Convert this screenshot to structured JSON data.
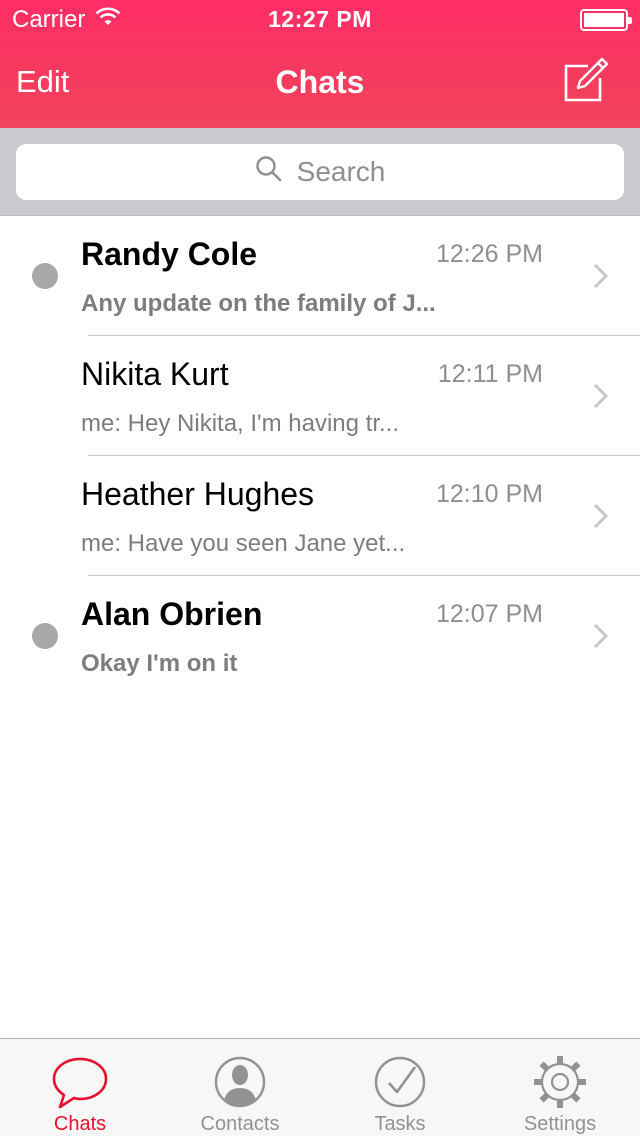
{
  "status_bar": {
    "carrier": "Carrier",
    "time": "12:27 PM"
  },
  "nav": {
    "edit_label": "Edit",
    "title": "Chats",
    "compose_icon": "compose-icon"
  },
  "search": {
    "placeholder": "Search"
  },
  "chats": [
    {
      "name": "Randy Cole",
      "time": "12:26 PM",
      "preview": "Any update on the family of J...",
      "unread": true
    },
    {
      "name": "Nikita Kurt",
      "time": "12:11 PM",
      "preview": "me: Hey Nikita, I'm having tr...",
      "unread": false
    },
    {
      "name": "Heather Hughes",
      "time": "12:10 PM",
      "preview": "me: Have you seen Jane yet...",
      "unread": false
    },
    {
      "name": "Alan Obrien",
      "time": "12:07 PM",
      "preview": "Okay I'm on it",
      "unread": true
    }
  ],
  "tabs": [
    {
      "label": "Chats",
      "icon": "chat-bubble-icon",
      "active": true
    },
    {
      "label": "Contacts",
      "icon": "person-icon",
      "active": false
    },
    {
      "label": "Tasks",
      "icon": "checkmark-icon",
      "active": false
    },
    {
      "label": "Settings",
      "icon": "gear-icon",
      "active": false
    }
  ],
  "colors": {
    "header_top": "#ff2d66",
    "header_bottom": "#f0445a",
    "accent": "#e8102c",
    "unread_dot": "#a8a8a8"
  }
}
